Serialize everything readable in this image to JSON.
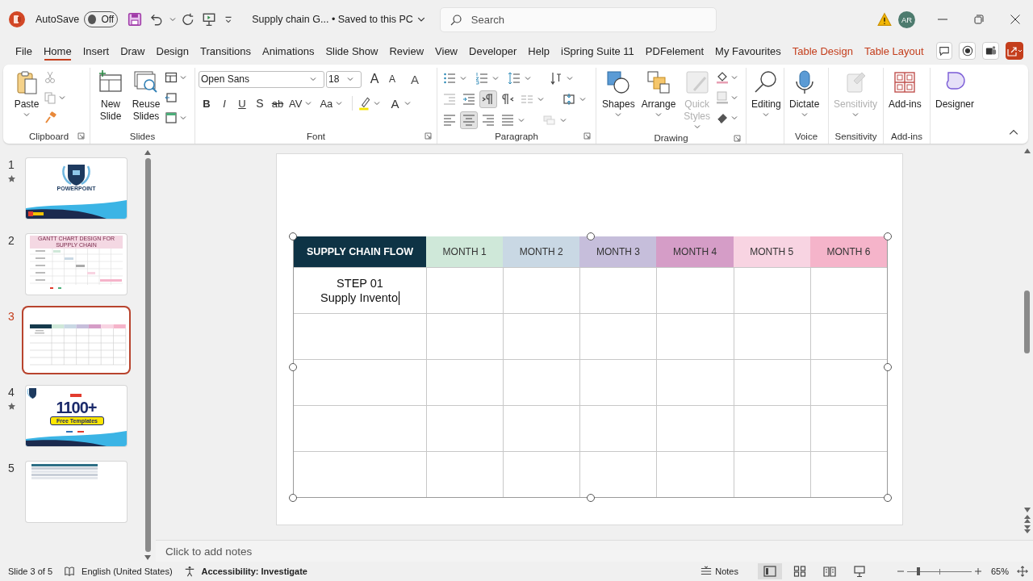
{
  "title_bar": {
    "autosave_label": "AutoSave",
    "autosave": {
      "label": "Off",
      "on": false
    },
    "document_title": "Supply chain G... • Saved to this PC",
    "search": {
      "placeholder": "Search"
    },
    "avatar": "AR"
  },
  "menu_tabs": [
    {
      "label": "File",
      "selected": false,
      "kind": "normal"
    },
    {
      "label": "Home",
      "selected": true,
      "kind": "normal"
    },
    {
      "label": "Insert",
      "selected": false,
      "kind": "normal"
    },
    {
      "label": "Draw",
      "selected": false,
      "kind": "normal"
    },
    {
      "label": "Design",
      "selected": false,
      "kind": "normal"
    },
    {
      "label": "Transitions",
      "selected": false,
      "kind": "normal"
    },
    {
      "label": "Animations",
      "selected": false,
      "kind": "normal"
    },
    {
      "label": "Slide Show",
      "selected": false,
      "kind": "normal"
    },
    {
      "label": "Review",
      "selected": false,
      "kind": "normal"
    },
    {
      "label": "View",
      "selected": false,
      "kind": "normal"
    },
    {
      "label": "Developer",
      "selected": false,
      "kind": "normal"
    },
    {
      "label": "Help",
      "selected": false,
      "kind": "normal"
    },
    {
      "label": "iSpring Suite 11",
      "selected": false,
      "kind": "normal"
    },
    {
      "label": "PDFelement",
      "selected": false,
      "kind": "normal"
    },
    {
      "label": "My Favourites",
      "selected": false,
      "kind": "normal"
    },
    {
      "label": "Table Design",
      "selected": false,
      "kind": "contextual"
    },
    {
      "label": "Table Layout",
      "selected": false,
      "kind": "contextual"
    }
  ],
  "ribbon": {
    "groups": [
      {
        "kind": "clipboard",
        "label": "Clipboard",
        "buttons": [
          {
            "label": "Paste",
            "disabled": false
          }
        ]
      },
      {
        "kind": "slides",
        "label": "Slides",
        "buttons": [
          {
            "label": "New Slide",
            "disabled": false
          },
          {
            "label": "Reuse Slides",
            "disabled": false
          }
        ]
      },
      {
        "kind": "font",
        "label": "Font",
        "font_name": "Open Sans",
        "font_size": "18",
        "grow": "A",
        "shrink": "A",
        "clear": "A",
        "format_buttons": [
          "B",
          "I",
          "U",
          "S",
          "ab",
          "AV",
          "Aa"
        ],
        "font_color": "A"
      },
      {
        "kind": "paragraph",
        "label": "Paragraph",
        "direction": [
          {
            "kind": "ltr",
            "selected": true
          },
          {
            "kind": "rtl",
            "selected": false
          }
        ],
        "alignment": [
          {
            "kind": "left",
            "selected": false
          },
          {
            "kind": "center",
            "selected": true
          },
          {
            "kind": "right",
            "selected": false
          },
          {
            "kind": "justify",
            "selected": false
          }
        ]
      },
      {
        "kind": "drawing",
        "label": "Drawing",
        "buttons": [
          {
            "label": "Shapes",
            "disabled": false
          },
          {
            "label": "Arrange",
            "disabled": false
          },
          {
            "label": "Quick Styles",
            "disabled": true
          }
        ]
      },
      {
        "kind": "editing",
        "buttons": [
          {
            "label": "Editing",
            "disabled": false
          }
        ]
      },
      {
        "kind": "voice",
        "label": "Voice",
        "buttons": [
          {
            "label": "Dictate",
            "disabled": false
          }
        ]
      },
      {
        "kind": "sensitivity",
        "label": "Sensitivity",
        "buttons": [
          {
            "label": "Sensitivity",
            "disabled": true
          }
        ]
      },
      {
        "kind": "addins",
        "label": "Add-ins",
        "buttons": [
          {
            "label": "Add-ins",
            "disabled": false
          }
        ]
      },
      {
        "kind": "designer",
        "buttons": [
          {
            "label": "Designer",
            "disabled": false
          }
        ]
      }
    ]
  },
  "slides_panel": {
    "thumbnails": [
      {
        "number": "1",
        "starred": true,
        "selected": false,
        "kind": "title",
        "texts": [
          "POWERPOINT"
        ]
      },
      {
        "number": "2",
        "starred": false,
        "selected": false,
        "kind": "gantt",
        "texts": [
          "GANTT CHART DESIGN FOR SUPPLY CHAIN"
        ]
      },
      {
        "number": "3",
        "starred": false,
        "selected": true,
        "kind": "table"
      },
      {
        "number": "4",
        "starred": true,
        "selected": false,
        "kind": "promo",
        "texts": [
          "1100+",
          "Free Templates"
        ]
      },
      {
        "number": "5",
        "starred": false,
        "selected": false,
        "kind": "striped"
      }
    ]
  },
  "slide": {
    "table": {
      "columns": [
        {
          "label": "SUPPLY CHAIN FLOW",
          "color": "#0e3345"
        },
        {
          "label": "MONTH 1",
          "color": "#cfe8d9"
        },
        {
          "label": "MONTH 2",
          "color": "#c9d8e4"
        },
        {
          "label": "MONTH 3",
          "color": "#c6bedb"
        },
        {
          "label": "MONTH 4",
          "color": "#d59dc7"
        },
        {
          "label": "MONTH 5",
          "color": "#f8d4e2"
        },
        {
          "label": "MONTH 6",
          "color": "#f5b4ca"
        }
      ],
      "rows": [
        {
          "first_cell": {
            "lines": [
              "STEP 01",
              "Supply Invento"
            ],
            "editing": true
          }
        },
        {},
        {},
        {},
        {}
      ]
    }
  },
  "notes": {
    "placeholder": "Click to add notes"
  },
  "status_bar": {
    "slide_info": "Slide 3 of 5",
    "language": "English (United States)",
    "accessibility": "Accessibility: Investigate",
    "notes_button": "Notes",
    "views": [
      {
        "kind": "normal",
        "selected": true
      },
      {
        "kind": "sorter",
        "selected": false
      },
      {
        "kind": "reading",
        "selected": false
      },
      {
        "kind": "slideshow",
        "selected": false
      }
    ],
    "zoom": {
      "level": 0.18,
      "reading": "65%"
    }
  }
}
